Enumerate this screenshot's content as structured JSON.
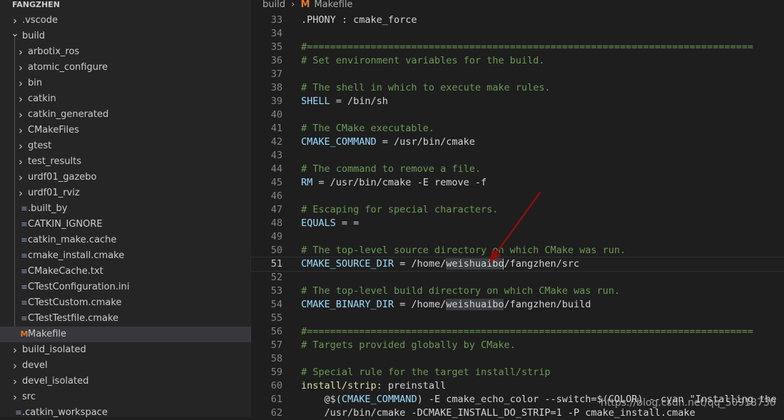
{
  "explorer": {
    "title": "FANGZHEN",
    "items": [
      {
        "label": ".vscode",
        "type": "folder",
        "depth": 0
      },
      {
        "label": "build",
        "type": "folder-open",
        "depth": 0
      },
      {
        "label": "arbotix_ros",
        "type": "folder",
        "depth": 1
      },
      {
        "label": "atomic_configure",
        "type": "folder",
        "depth": 1
      },
      {
        "label": "bin",
        "type": "folder",
        "depth": 1
      },
      {
        "label": "catkin",
        "type": "folder",
        "depth": 1
      },
      {
        "label": "catkin_generated",
        "type": "folder",
        "depth": 1
      },
      {
        "label": "CMakeFiles",
        "type": "folder",
        "depth": 1
      },
      {
        "label": "gtest",
        "type": "folder",
        "depth": 1
      },
      {
        "label": "test_results",
        "type": "folder",
        "depth": 1
      },
      {
        "label": "urdf01_gazebo",
        "type": "folder",
        "depth": 1
      },
      {
        "label": "urdf01_rviz",
        "type": "folder",
        "depth": 1
      },
      {
        "label": ".built_by",
        "type": "file",
        "depth": 1
      },
      {
        "label": "CATKIN_IGNORE",
        "type": "file",
        "depth": 1
      },
      {
        "label": "catkin_make.cache",
        "type": "file",
        "depth": 1
      },
      {
        "label": "cmake_install.cmake",
        "type": "file",
        "depth": 1
      },
      {
        "label": "CMakeCache.txt",
        "type": "file",
        "depth": 1
      },
      {
        "label": "CTestConfiguration.ini",
        "type": "file",
        "depth": 1
      },
      {
        "label": "CTestCustom.cmake",
        "type": "file",
        "depth": 1
      },
      {
        "label": "CTestTestfile.cmake",
        "type": "file",
        "depth": 1
      },
      {
        "label": "Makefile",
        "type": "makefile",
        "depth": 1,
        "selected": true
      },
      {
        "label": "build_isolated",
        "type": "folder",
        "depth": 0
      },
      {
        "label": "devel",
        "type": "folder",
        "depth": 0
      },
      {
        "label": "devel_isolated",
        "type": "folder",
        "depth": 0
      },
      {
        "label": "src",
        "type": "folder",
        "depth": 0
      },
      {
        "label": ".catkin_workspace",
        "type": "file",
        "depth": 0
      }
    ]
  },
  "breadcrumb": {
    "folder": "build",
    "file": "Makefile",
    "file_icon": "M"
  },
  "editor": {
    "top_partial_line": "32",
    "current_line": "51",
    "lines": [
      {
        "n": "33",
        "parts": [
          {
            "t": ".PHONY : cmake_force",
            "c": "p"
          }
        ]
      },
      {
        "n": "34",
        "parts": []
      },
      {
        "n": "35",
        "parts": [
          {
            "t": "#=============================================================================",
            "c": "c"
          }
        ]
      },
      {
        "n": "36",
        "parts": [
          {
            "t": "# Set environment variables for the build.",
            "c": "c"
          }
        ]
      },
      {
        "n": "37",
        "parts": []
      },
      {
        "n": "38",
        "parts": [
          {
            "t": "# The shell in which to execute make rules.",
            "c": "c"
          }
        ]
      },
      {
        "n": "39",
        "parts": [
          {
            "t": "SHELL",
            "c": "v"
          },
          {
            "t": " = /bin/sh",
            "c": "p"
          }
        ]
      },
      {
        "n": "40",
        "parts": []
      },
      {
        "n": "41",
        "parts": [
          {
            "t": "# The CMake executable.",
            "c": "c"
          }
        ]
      },
      {
        "n": "42",
        "parts": [
          {
            "t": "CMAKE_COMMAND",
            "c": "v"
          },
          {
            "t": " = /usr/bin/cmake",
            "c": "p"
          }
        ]
      },
      {
        "n": "43",
        "parts": []
      },
      {
        "n": "44",
        "parts": [
          {
            "t": "# The command to remove a file.",
            "c": "c"
          }
        ]
      },
      {
        "n": "45",
        "parts": [
          {
            "t": "RM",
            "c": "v"
          },
          {
            "t": " = /usr/bin/cmake -E remove -f",
            "c": "p"
          }
        ]
      },
      {
        "n": "46",
        "parts": []
      },
      {
        "n": "47",
        "parts": [
          {
            "t": "# Escaping for special characters.",
            "c": "c"
          }
        ]
      },
      {
        "n": "48",
        "parts": [
          {
            "t": "EQUALS",
            "c": "v"
          },
          {
            "t": " = =",
            "c": "p"
          }
        ]
      },
      {
        "n": "49",
        "parts": []
      },
      {
        "n": "50",
        "parts": [
          {
            "t": "# The top-level source directory on which CMake was run.",
            "c": "c"
          }
        ]
      },
      {
        "n": "51",
        "parts": [
          {
            "t": "CMAKE_SOURCE_DIR",
            "c": "v"
          },
          {
            "t": " = /home/",
            "c": "p"
          },
          {
            "t": "weishuaibo",
            "c": "p",
            "hl": true,
            "caret": true
          },
          {
            "t": "/fangzhen/src",
            "c": "p"
          }
        ]
      },
      {
        "n": "52",
        "parts": []
      },
      {
        "n": "53",
        "parts": [
          {
            "t": "# The top-level build directory on which CMake was run.",
            "c": "c"
          }
        ]
      },
      {
        "n": "54",
        "parts": [
          {
            "t": "CMAKE_BINARY_DIR",
            "c": "v"
          },
          {
            "t": " = /home/",
            "c": "p"
          },
          {
            "t": "weishuaibo",
            "c": "p",
            "hl": true
          },
          {
            "t": "/fangzhen/build",
            "c": "p"
          }
        ]
      },
      {
        "n": "55",
        "parts": []
      },
      {
        "n": "56",
        "parts": [
          {
            "t": "#=============================================================================",
            "c": "c"
          }
        ]
      },
      {
        "n": "57",
        "parts": [
          {
            "t": "# Targets provided globally by CMake.",
            "c": "c"
          }
        ]
      },
      {
        "n": "58",
        "parts": []
      },
      {
        "n": "59",
        "parts": [
          {
            "t": "# Special rule for the target install/strip",
            "c": "c"
          }
        ]
      },
      {
        "n": "60",
        "parts": [
          {
            "t": "install/strip",
            "c": "f"
          },
          {
            "t": ": preinstall",
            "c": "p"
          }
        ]
      },
      {
        "n": "61",
        "parts": [
          {
            "t": "    @$(",
            "c": "o"
          },
          {
            "t": "CMAKE_COMMAND",
            "c": "v"
          },
          {
            "t": ") -E cmake_echo_color --switch=$(COLOR) --cyan \"Installing the",
            "c": "p"
          }
        ]
      },
      {
        "n": "62",
        "parts": [
          {
            "t": "    /usr/bin/cmake -DCMAKE_INSTALL_DO_STRIP=1 -P cmake_install.cmake",
            "c": "p"
          }
        ]
      }
    ]
  },
  "watermark": "https://blog.csdn.net/qq_50918730",
  "colors": {
    "comment": "#6a9955",
    "variable": "#9cdcfe",
    "target": "#dcdcaa",
    "annotation_arrow": "#8b0f0f",
    "makefile_icon": "#e37933"
  }
}
